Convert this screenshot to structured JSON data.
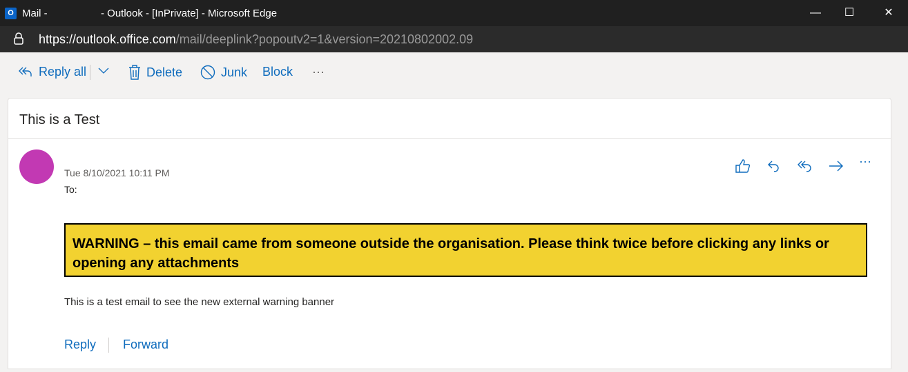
{
  "window": {
    "title_prefix": "Mail -",
    "title_suffix": "- Outlook - [InPrivate] - Microsoft Edge",
    "logo": "O"
  },
  "address": {
    "host": "https://outlook.office.com",
    "path": "/mail/deeplink?popoutv2=1&version=20210802002.09"
  },
  "toolbar": {
    "reply_all": "Reply all",
    "delete": "Delete",
    "junk": "Junk",
    "block": "Block",
    "more": "···"
  },
  "message": {
    "subject": "This is a Test",
    "date": "Tue 8/10/2021 10:11 PM",
    "to_label": "To:",
    "warning": "WARNING – this email came from someone outside the organisation. Please think twice before clicking any links or opening any attachments",
    "body": "This is a test email to see the new external warning banner",
    "reply": "Reply",
    "forward": "Forward",
    "more": "···"
  },
  "colors": {
    "accent": "#0f6cbd",
    "banner": "#f2d230",
    "avatar": "#c239b3"
  }
}
